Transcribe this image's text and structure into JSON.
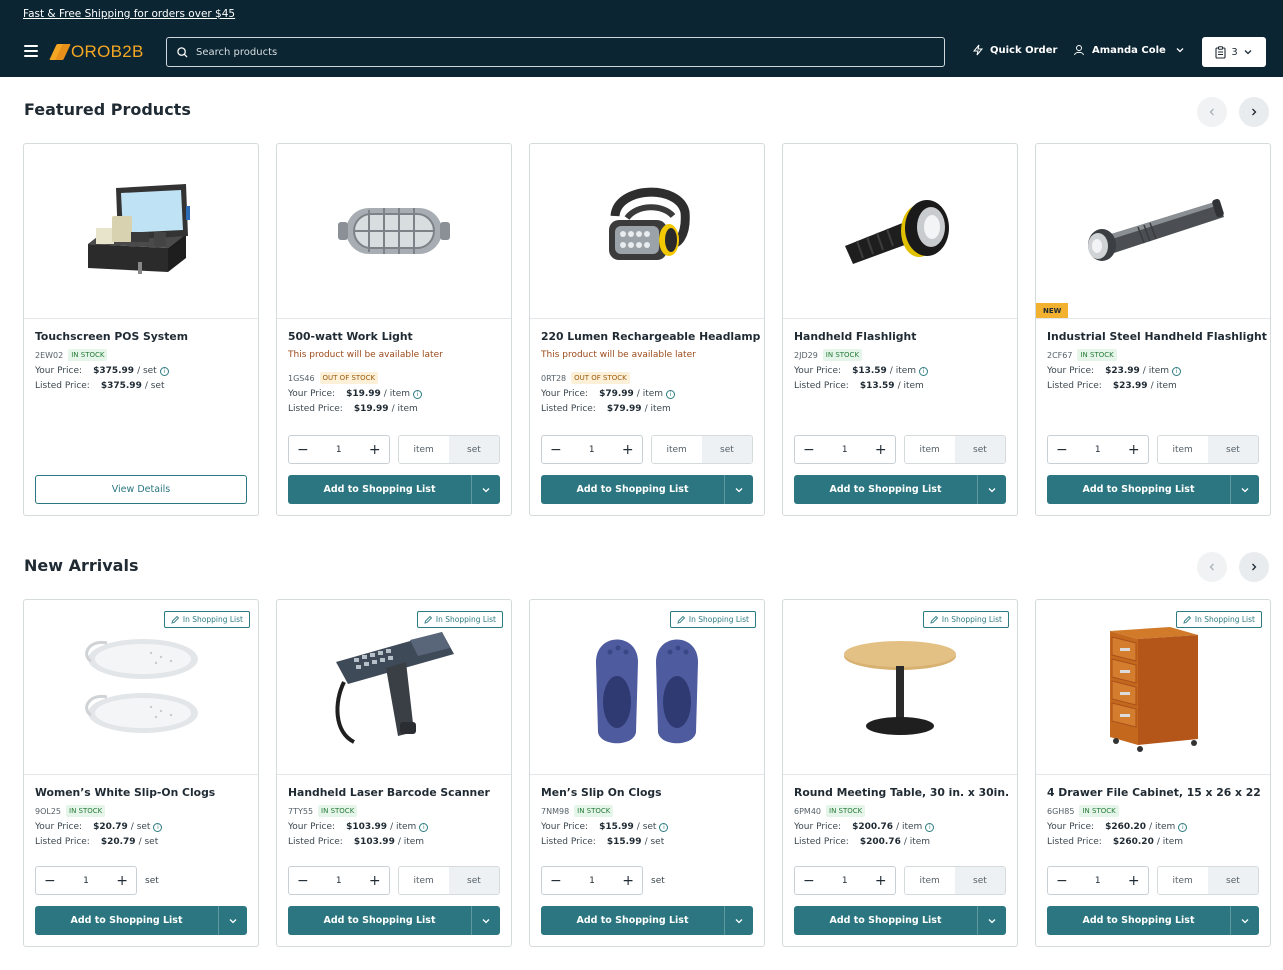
{
  "header": {
    "promo": "Fast & Free Shipping for orders over $45",
    "logo": "OROB2B",
    "search_placeholder": "Search products",
    "quick_order": "Quick Order",
    "user_name": "Amanda Cole",
    "cart_count": "3"
  },
  "featured": {
    "title": "Featured Products",
    "products": [
      {
        "name": "Touchscreen POS System",
        "avail": "",
        "sku": "2EW02",
        "stock": "IN STOCK",
        "stock_class": "in",
        "your_price": "$375.99",
        "your_unit": "/ set",
        "listed_price": "$375.99",
        "listed_unit": "/ set",
        "badge": "",
        "action": "view",
        "view_label": "View Details",
        "image": "pos"
      },
      {
        "name": "500-watt Work Light",
        "avail": "This product will be available later",
        "sku": "1GS46",
        "stock": "OUT OF STOCK",
        "stock_class": "out",
        "your_price": "$19.99",
        "your_unit": "/ item",
        "listed_price": "$19.99",
        "listed_unit": "/ item",
        "badge": "",
        "action": "add",
        "image": "worklight"
      },
      {
        "name": "220 Lumen Rechargeable Headlamp",
        "avail": "This product will be available later",
        "sku": "0RT28",
        "stock": "OUT OF STOCK",
        "stock_class": "out",
        "your_price": "$79.99",
        "your_unit": "/ item",
        "listed_price": "$79.99",
        "listed_unit": "/ item",
        "badge": "",
        "action": "add",
        "image": "headlamp"
      },
      {
        "name": "Handheld Flashlight",
        "avail": "",
        "sku": "2JD29",
        "stock": "IN STOCK",
        "stock_class": "in",
        "your_price": "$13.59",
        "your_unit": "/ item",
        "listed_price": "$13.59",
        "listed_unit": "/ item",
        "badge": "",
        "action": "add",
        "image": "flashlight"
      },
      {
        "name": "Industrial Steel Handheld Flashlight",
        "avail": "",
        "sku": "2CF67",
        "stock": "IN STOCK",
        "stock_class": "in",
        "your_price": "$23.99",
        "your_unit": "/ item",
        "listed_price": "$23.99",
        "listed_unit": "/ item",
        "badge": "NEW",
        "action": "add",
        "image": "steelflash"
      }
    ]
  },
  "arrivals": {
    "title": "New Arrivals",
    "products": [
      {
        "name": "Women’s White Slip-On Clogs",
        "sku": "9OL25",
        "stock": "IN STOCK",
        "your_price": "$20.79",
        "your_unit": "/ set",
        "listed_price": "$20.79",
        "listed_unit": "/ set",
        "units_mode": "single",
        "image": "whiteclogs"
      },
      {
        "name": "Handheld Laser Barcode Scanner",
        "sku": "7TY55",
        "stock": "IN STOCK",
        "your_price": "$103.99",
        "your_unit": "/ item",
        "listed_price": "$103.99",
        "listed_unit": "/ item",
        "units_mode": "toggle",
        "image": "scanner"
      },
      {
        "name": "Men’s Slip On Clogs",
        "sku": "7NM98",
        "stock": "IN STOCK",
        "your_price": "$15.99",
        "your_unit": "/ set",
        "listed_price": "$15.99",
        "listed_unit": "/ set",
        "units_mode": "single",
        "image": "blueclogs"
      },
      {
        "name": "Round Meeting Table, 30 in. x 30in.",
        "sku": "6PM40",
        "stock": "IN STOCK",
        "your_price": "$200.76",
        "your_unit": "/ item",
        "listed_price": "$200.76",
        "listed_unit": "/ item",
        "units_mode": "toggle",
        "image": "table"
      },
      {
        "name": "4 Drawer File Cabinet, 15 x 26 x 22",
        "sku": "6GH85",
        "stock": "IN STOCK",
        "your_price": "$260.20",
        "your_unit": "/ item",
        "listed_price": "$260.20",
        "listed_unit": "/ item",
        "units_mode": "toggle",
        "image": "cabinet"
      }
    ]
  },
  "labels": {
    "your_price": "Your Price:",
    "listed_price": "Listed Price:",
    "add_to_list": "Add to Shopping List",
    "in_shopping_list": "In Shopping List",
    "unit_item": "item",
    "unit_set": "set",
    "qty": "1"
  },
  "colors": {
    "header_bg": "#0b2532",
    "accent": "#2b7680",
    "brand": "#f5a623"
  }
}
